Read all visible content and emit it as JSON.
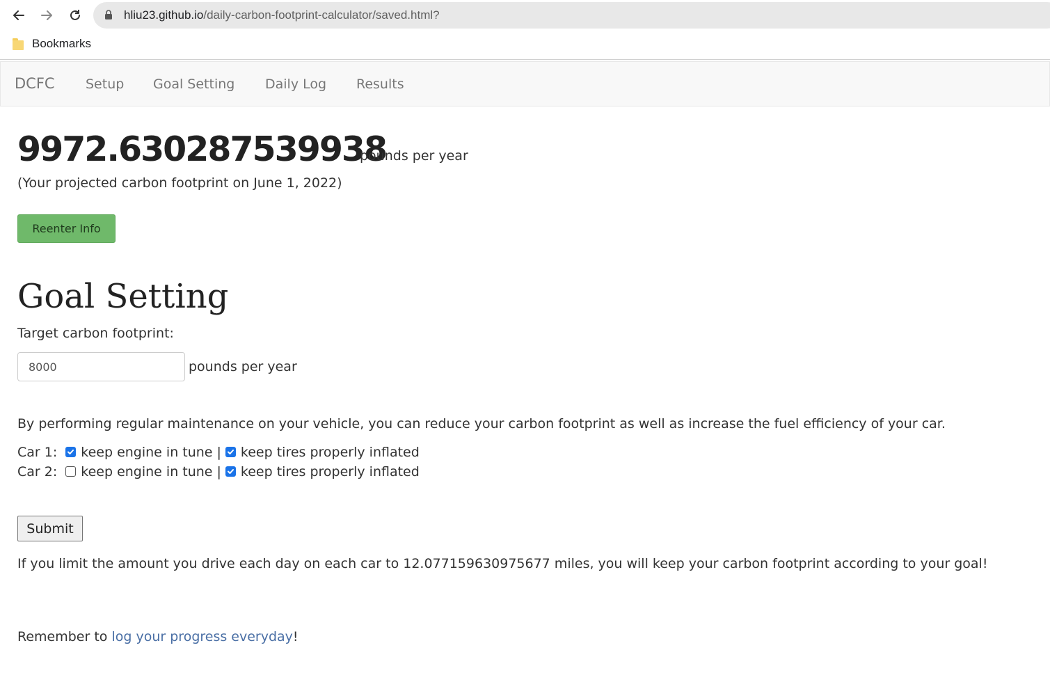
{
  "browser": {
    "url_host": "hliu23.github.io",
    "url_path": "/daily-carbon-footprint-calculator/saved.html?",
    "bookmarks_label": "Bookmarks"
  },
  "navbar": {
    "brand": "DCFC",
    "links": [
      "Setup",
      "Goal Setting",
      "Daily Log",
      "Results"
    ]
  },
  "footprint": {
    "value": "9972.630287539938",
    "unit": "pounds per year",
    "caption": "(Your projected carbon footprint on June 1, 2022)",
    "reenter_label": "Reenter Info"
  },
  "goal": {
    "heading": "Goal Setting",
    "target_label": "Target carbon footprint:",
    "target_value": "8000",
    "target_unit": "pounds per year",
    "maintenance_text": "By performing regular maintenance on your vehicle, you can reduce your carbon footprint as well as increase the fuel efficiency of your car.",
    "cars": [
      {
        "label": "Car 1:",
        "engine_label": "keep engine in tune",
        "engine_checked": true,
        "tires_label": "keep tires properly inflated",
        "tires_checked": true
      },
      {
        "label": "Car 2:",
        "engine_label": "keep engine in tune",
        "engine_checked": false,
        "tires_label": "keep tires properly inflated",
        "tires_checked": true
      }
    ],
    "separator": "|",
    "submit_label": "Submit",
    "limit_text": "If you limit the amount you drive each day on each car to 12.077159630975677 miles, you will keep your carbon footprint according to your goal!"
  },
  "reminder": {
    "prefix": "Remember to ",
    "link": "log your progress everyday",
    "suffix": "!"
  },
  "colors": {
    "accent_green": "#6fb96a",
    "checkbox_blue": "#1a73e8",
    "link_blue": "#4a6fa5"
  }
}
